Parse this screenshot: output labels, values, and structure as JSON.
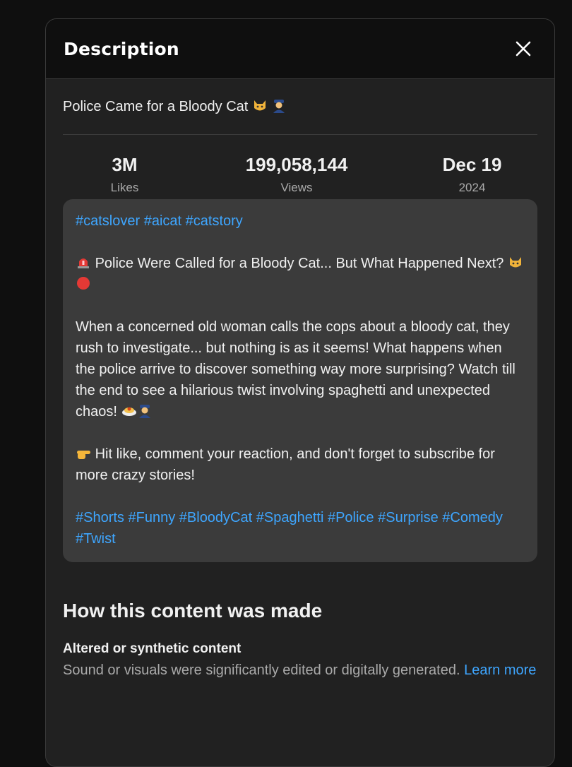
{
  "panel": {
    "title": "Description",
    "close_icon": "close-icon"
  },
  "video": {
    "title": "Police Came for a Bloody Cat",
    "title_emojis": [
      "cat-face-icon",
      "police-officer-icon"
    ]
  },
  "stats": {
    "likes": {
      "value": "3M",
      "label": "Likes"
    },
    "views": {
      "value": "199,058,144",
      "label": "Views"
    },
    "date": {
      "value": "Dec 19",
      "label": "2024"
    }
  },
  "description": {
    "top_hashtags": [
      "#catslover",
      "#aicat",
      "#catstory"
    ],
    "headline": "Police Were Called for a Bloody Cat... But What Happened Next?",
    "body": "When a concerned old woman calls the cops about a bloody cat, they rush to investigate... but nothing is as it seems! What happens when the police arrive to discover something way more surprising? Watch till the end to see a hilarious twist involving spaghetti and unexpected chaos!",
    "cta": "Hit like, comment your reaction, and don't forget to subscribe for more crazy stories!",
    "bottom_hashtags": [
      "#Shorts",
      "#Funny",
      "#BloodyCat",
      "#Spaghetti",
      "#Police",
      "#Surprise",
      "#Comedy",
      "#Twist"
    ]
  },
  "content_made": {
    "title": "How this content was made",
    "subtitle": "Altered or synthetic content",
    "text": "Sound or visuals were significantly edited or digitally generated.",
    "link": "Learn more"
  },
  "colors": {
    "background": "#0f0f0f",
    "panel": "#212121",
    "desc_box": "#3b3b3b",
    "link": "#3ea6ff",
    "secondary_text": "#aaaaaa"
  }
}
